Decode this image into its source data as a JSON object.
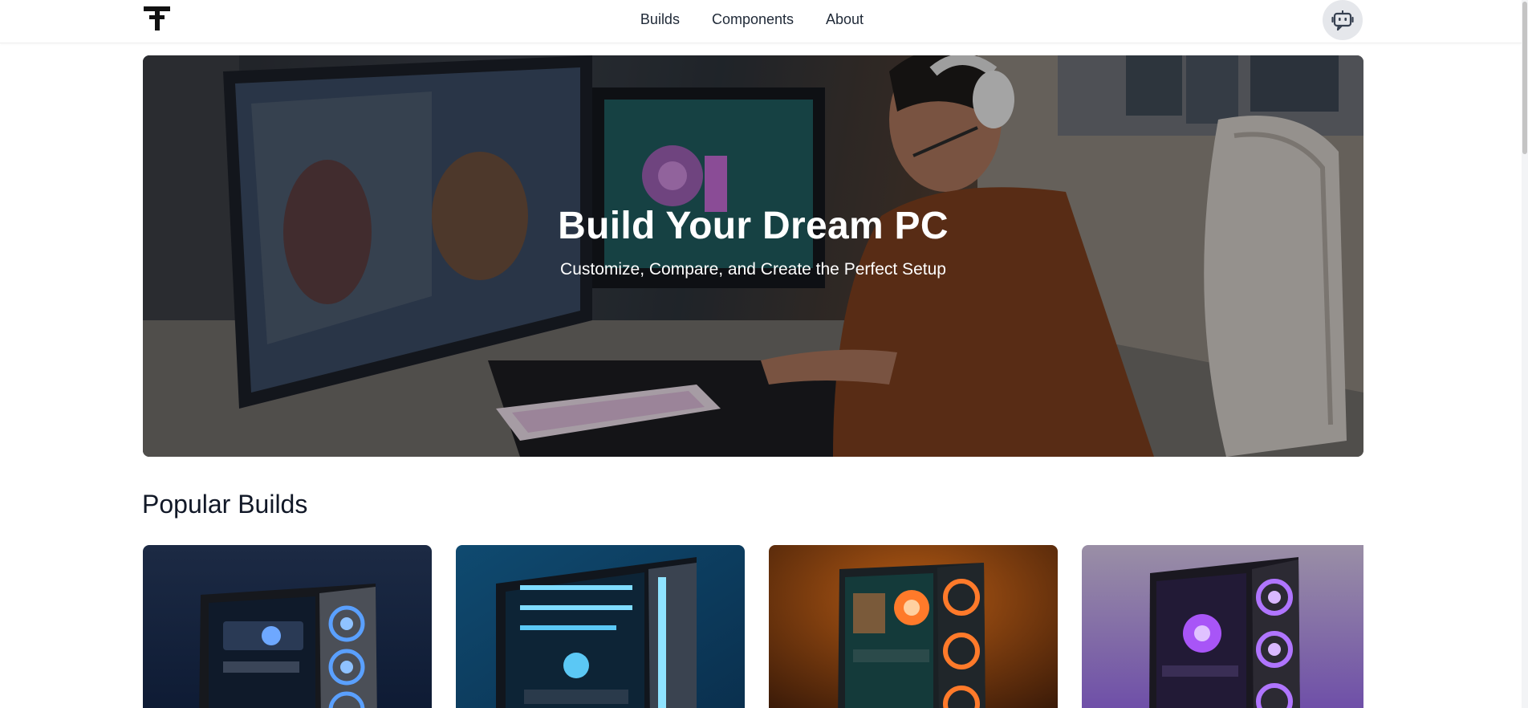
{
  "nav": {
    "logo_icon": "tf-monogram-logo",
    "links": [
      "Builds",
      "Components",
      "About"
    ],
    "chat_icon": "chatbot-icon"
  },
  "hero": {
    "title": "Build Your Dream PC",
    "subtitle": "Customize, Compare, and Create the Perfect Setup"
  },
  "popular": {
    "heading": "Popular Builds",
    "cards": [
      {
        "image": "pc-build-blue-fans",
        "accent": "#4a90e2"
      },
      {
        "image": "pc-build-cyan-glass",
        "accent": "#38bdf8"
      },
      {
        "image": "pc-build-orange-fans",
        "accent": "#f97316"
      },
      {
        "image": "pc-build-purple-fans",
        "accent": "#a855f7"
      }
    ]
  }
}
